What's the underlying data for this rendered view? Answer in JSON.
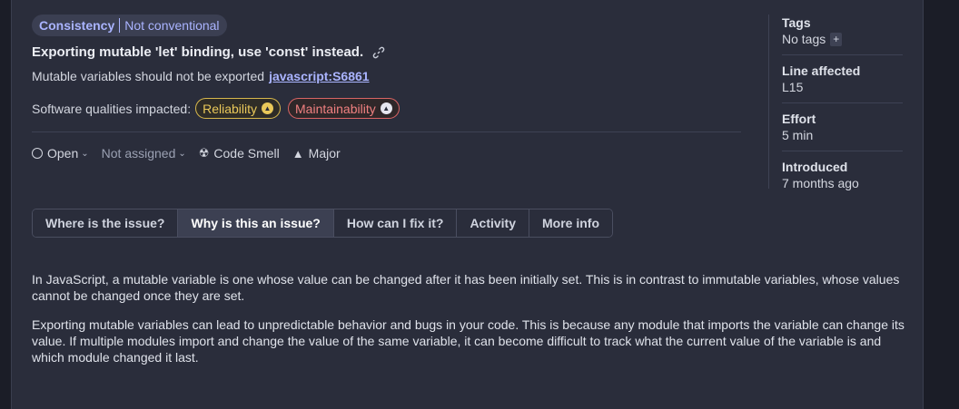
{
  "tag": {
    "category": "Consistency",
    "sub": "Not conventional"
  },
  "issue": {
    "title": "Exporting mutable 'let' binding, use 'const' instead.",
    "description": "Mutable variables should not be exported",
    "rule": "javascript:S6861"
  },
  "qualities": {
    "label": "Software qualities impacted:",
    "items": [
      "Reliability",
      "Maintainability"
    ]
  },
  "meta": {
    "status": "Open",
    "assignee": "Not assigned",
    "type": "Code Smell",
    "severity": "Major"
  },
  "tabs": [
    "Where is the issue?",
    "Why is this an issue?",
    "How can I fix it?",
    "Activity",
    "More info"
  ],
  "active_tab": "Why is this an issue?",
  "body": [
    "In JavaScript, a mutable variable is one whose value can be changed after it has been initially set. This is in contrast to immutable variables, whose values cannot be changed once they are set.",
    "Exporting mutable variables can lead to unpredictable behavior and bugs in your code. This is because any module that imports the variable can change its value. If multiple modules import and change the value of the same variable, it can become difficult to track what the current value of the variable is and which module changed it last."
  ],
  "sidebar": {
    "tags": {
      "label": "Tags",
      "value": "No tags",
      "add": "+"
    },
    "line": {
      "label": "Line affected",
      "value": "L15"
    },
    "effort": {
      "label": "Effort",
      "value": "5 min"
    },
    "introduced": {
      "label": "Introduced",
      "value": "7 months ago"
    }
  },
  "colors": {
    "accent": "#aab4ff",
    "reliability": "#e9c85a",
    "maintainability": "#f08080",
    "panel": "#2a2d3b"
  }
}
